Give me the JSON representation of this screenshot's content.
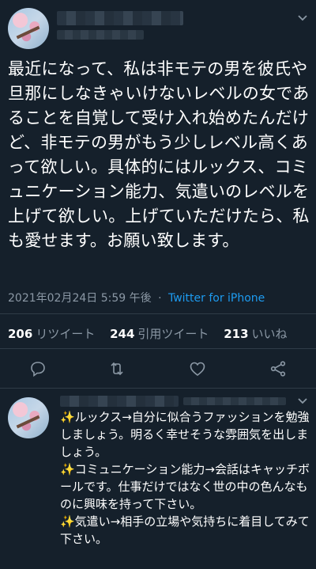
{
  "tweet": {
    "text": "最近になって、私は非モテの男を彼氏や旦那にしなきゃいけないレベルの女であることを自覚して受け入れ始めたんだけど、非モテの男がもう少しレベル高くあって欲しい。具体的にはルックス、コミュニケーション能力、気遣いのレベルを上げて欲しい。上げていただけたら、私も愛せます。お願い致します。",
    "timestamp": "2021年02月24日 5:59 午後",
    "dot": "·",
    "client": "Twitter for iPhone"
  },
  "stats": {
    "retweets_count": "206",
    "retweets_label": "リツイート",
    "quotes_count": "244",
    "quotes_label": "引用ツイート",
    "likes_count": "213",
    "likes_label": "いいね"
  },
  "icons": {
    "reply": "reply-icon",
    "retweet": "retweet-icon",
    "like": "heart-icon",
    "share": "share-icon",
    "more": "chevron-down-icon"
  },
  "reply": {
    "text": "✨ルックス→自分に似合うファッションを勉強しましょう。明るく幸せそうな雰囲気を出しましょう。\n✨コミュニケーション能力→会話はキャッチボールです。仕事だけではなく世の中の色んなものに興味を持って下さい。\n✨気遣い→相手の立場や気持ちに着目してみて下さい。"
  },
  "colors": {
    "background": "#15202b",
    "text": "#ffffff",
    "muted": "#8b98a5",
    "accent": "#1d9bf0",
    "divider": "#2f3b47"
  }
}
